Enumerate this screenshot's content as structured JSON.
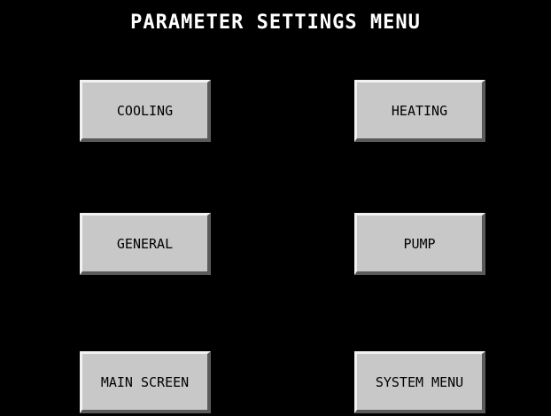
{
  "screen": {
    "title": "PARAMETER SETTINGS MENU"
  },
  "buttons": {
    "cooling": "COOLING",
    "heating": "HEATING",
    "general": "GENERAL",
    "pump": "PUMP",
    "main_screen": "MAIN SCREEN",
    "system_menu": "SYSTEM MENU"
  },
  "colors": {
    "background": "#000000",
    "title_text": "#ffffff",
    "button_face": "#c8c8c8",
    "button_highlight": "#f2f2f2",
    "button_shadow": "#5a5a5a",
    "button_text": "#000000"
  }
}
